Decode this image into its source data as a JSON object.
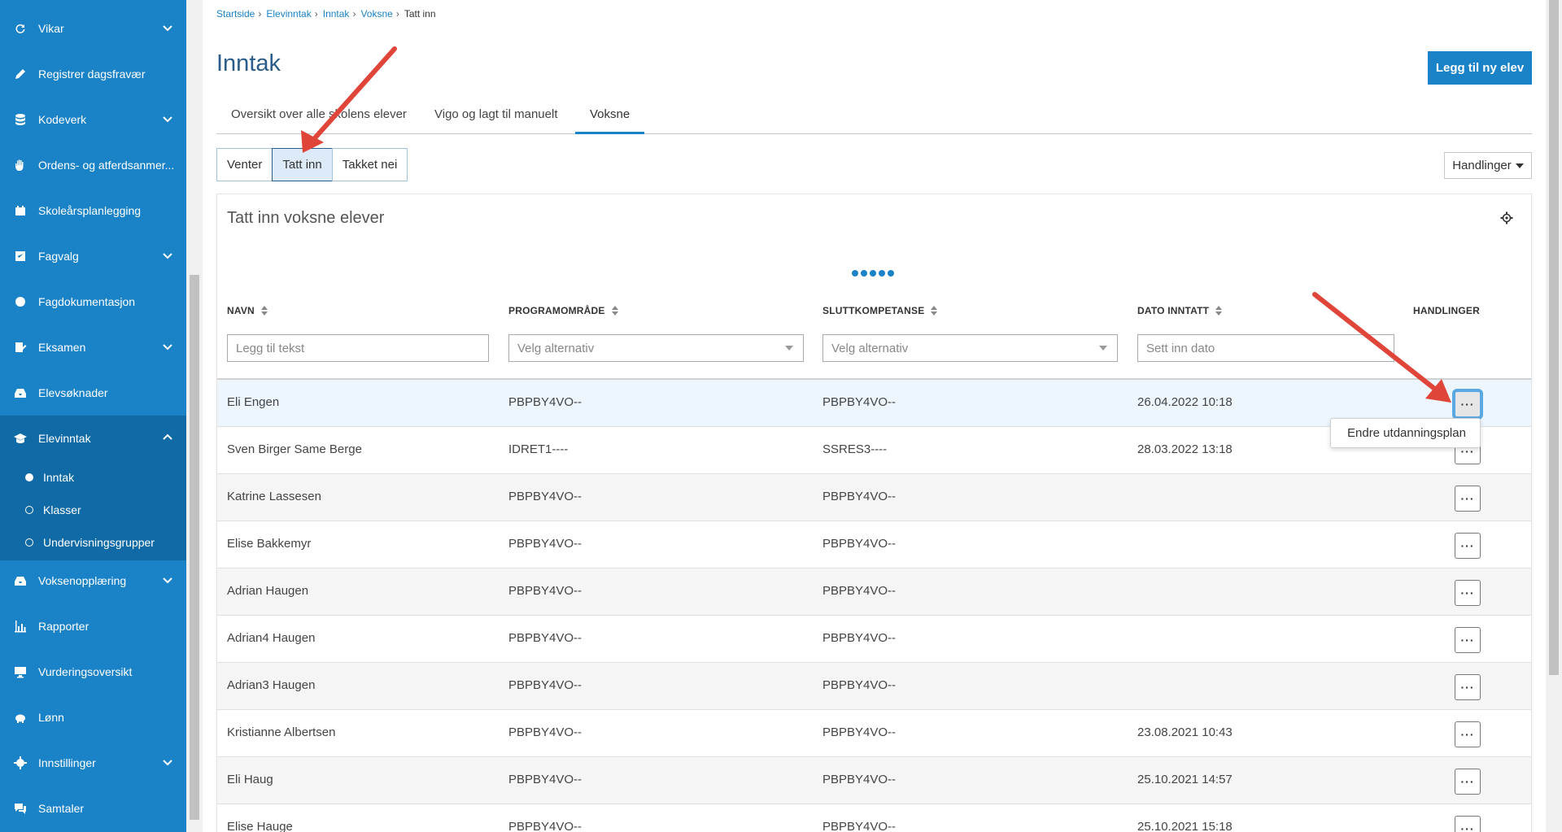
{
  "sidebar": {
    "items": [
      {
        "label": "Vikar",
        "icon": "refresh-icon",
        "chevron": true
      },
      {
        "label": "Registrer dagsfravær",
        "icon": "pencil-icon",
        "chevron": false
      },
      {
        "label": "Kodeverk",
        "icon": "database-icon",
        "chevron": true
      },
      {
        "label": "Ordens- og atferdsanmer...",
        "icon": "hand-icon",
        "chevron": false
      },
      {
        "label": "Skoleårsplanlegging",
        "icon": "calendar-icon",
        "chevron": false
      },
      {
        "label": "Fagvalg",
        "icon": "checklist-icon",
        "chevron": true
      },
      {
        "label": "Fagdokumentasjon",
        "icon": "badge-icon",
        "chevron": false
      },
      {
        "label": "Eksamen",
        "icon": "exam-icon",
        "chevron": true
      },
      {
        "label": "Elevsøknader",
        "icon": "inbox-icon",
        "chevron": false
      },
      {
        "label": "Elevinntak",
        "icon": "graduation-cap-icon",
        "chevron": true
      },
      {
        "label": "Voksenopplæring",
        "icon": "inbox-icon",
        "chevron": true
      },
      {
        "label": "Rapporter",
        "icon": "bar-chart-icon",
        "chevron": false
      },
      {
        "label": "Vurderingsoversikt",
        "icon": "monitor-icon",
        "chevron": false
      },
      {
        "label": "Lønn",
        "icon": "piggy-bank-icon",
        "chevron": false
      },
      {
        "label": "Innstillinger",
        "icon": "gear-icon",
        "chevron": true
      },
      {
        "label": "Samtaler",
        "icon": "chat-icon",
        "chevron": false
      }
    ],
    "subitems": [
      {
        "label": "Inntak",
        "selected": true
      },
      {
        "label": "Klasser",
        "selected": false
      },
      {
        "label": "Undervisningsgrupper",
        "selected": false
      }
    ]
  },
  "breadcrumb": [
    "Startside",
    "Elevinntak",
    "Inntak",
    "Voksne",
    "Tatt inn"
  ],
  "page": {
    "title": "Inntak",
    "add_button": "Legg til ny elev"
  },
  "tabs": [
    {
      "label": "Oversikt over alle skolens elever"
    },
    {
      "label": "Vigo og lagt til manuelt"
    },
    {
      "label": "Voksne"
    }
  ],
  "segments": [
    {
      "label": "Venter"
    },
    {
      "label": "Tatt inn"
    },
    {
      "label": "Takket nei"
    }
  ],
  "actions_dropdown": "Handlinger",
  "card": {
    "title": "Tatt inn voksne elever"
  },
  "table": {
    "columns": [
      "NAVN",
      "PROGRAMOMRÅDE",
      "SLUTTKOMPETANSE",
      "DATO INNTATT",
      "HANDLINGER"
    ],
    "filters": {
      "name_placeholder": "Legg til tekst",
      "program_placeholder": "Velg alternativ",
      "kompetanse_placeholder": "Velg alternativ",
      "date_placeholder": "Sett inn dato"
    },
    "rows": [
      {
        "name": "Eli Engen",
        "program": "PBPBY4VO--",
        "kompetanse": "PBPBY4VO--",
        "date": "26.04.2022 10:18"
      },
      {
        "name": "Sven Birger Same Berge",
        "program": "IDRET1----",
        "kompetanse": "SSRES3----",
        "date": "28.03.2022 13:18"
      },
      {
        "name": "Katrine Lassesen",
        "program": "PBPBY4VO--",
        "kompetanse": "PBPBY4VO--",
        "date": ""
      },
      {
        "name": "Elise Bakkemyr",
        "program": "PBPBY4VO--",
        "kompetanse": "PBPBY4VO--",
        "date": ""
      },
      {
        "name": "Adrian Haugen",
        "program": "PBPBY4VO--",
        "kompetanse": "PBPBY4VO--",
        "date": ""
      },
      {
        "name": "Adrian4 Haugen",
        "program": "PBPBY4VO--",
        "kompetanse": "PBPBY4VO--",
        "date": ""
      },
      {
        "name": "Adrian3 Haugen",
        "program": "PBPBY4VO--",
        "kompetanse": "PBPBY4VO--",
        "date": ""
      },
      {
        "name": "Kristianne Albertsen",
        "program": "PBPBY4VO--",
        "kompetanse": "PBPBY4VO--",
        "date": "23.08.2021 10:43"
      },
      {
        "name": "Eli Haug",
        "program": "PBPBY4VO--",
        "kompetanse": "PBPBY4VO--",
        "date": "25.10.2021 14:57"
      },
      {
        "name": "Elise Hauge",
        "program": "PBPBY4VO--",
        "kompetanse": "PBPBY4VO--",
        "date": "25.10.2021 15:18"
      }
    ],
    "more_label": "···"
  },
  "context_menu": {
    "item": "Endre utdanningsplan"
  },
  "colors": {
    "sidebar": "#1a82c6",
    "sidebar_active": "#0f6aa5",
    "accent": "#1a82c6",
    "annotation_arrow": "#e0453a"
  }
}
